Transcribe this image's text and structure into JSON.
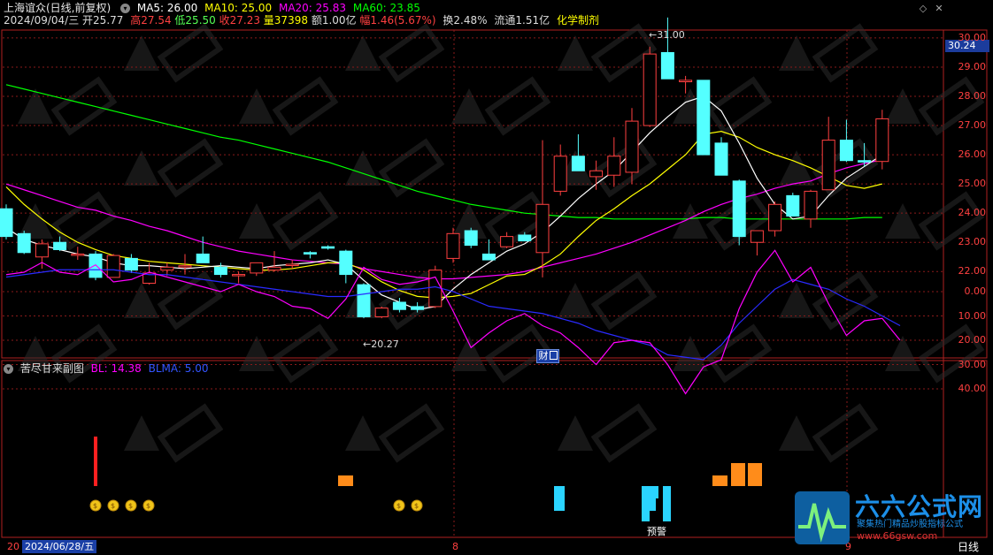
{
  "header": {
    "title": "上海谊众(日线,前复权)",
    "ma": [
      {
        "label": "MA5: 26.00",
        "color": "#ffffff"
      },
      {
        "label": "MA10: 25.00",
        "color": "#ffff00"
      },
      {
        "label": "MA20: 25.83",
        "color": "#ff00ff"
      },
      {
        "label": "MA60: 23.85",
        "color": "#00ff00"
      }
    ],
    "quote": {
      "date": "2024/09/04/三",
      "open_label": "开25.77",
      "high_label": "高27.54",
      "low_label": "低25.50",
      "close_label": "收27.23",
      "volume_label": "量37398",
      "amount_label": "额1.00亿",
      "change_label": "幅1.46(5.67%)",
      "turnover_label": "换2.48%",
      "float_label": "流通1.51亿",
      "industry": "化学制剂"
    }
  },
  "price_axis": {
    "current_price": "30.24",
    "ticks": [
      "30.00",
      "29.00",
      "28.00",
      "27.00",
      "26.00",
      "25.00",
      "24.00",
      "23.00",
      "22.00"
    ]
  },
  "annotations": {
    "high_marker": "31.00",
    "low_marker": "20.27",
    "report_badge": "财",
    "warning_label": "预警"
  },
  "sub_indicator": {
    "title": "苦尽甘来副图",
    "bl_label": "BL: 14.38",
    "blma_label": "BLMA: 5.00",
    "ticks": [
      "40.00",
      "30.00",
      "20.00",
      "10.00",
      "0.00"
    ]
  },
  "footer": {
    "date_badge": "2024/06/28/五",
    "left_tick": "20",
    "month_ticks": [
      "8",
      "9"
    ],
    "period": "日线"
  },
  "logo": {
    "title": "六六公式网",
    "subtitle": "聚集热门精品炒股指标公式",
    "url": "www.66gsw.com"
  },
  "chart_data": {
    "type": "candlestick",
    "colors": {
      "up": "#ff4040",
      "down": "#54ffff"
    },
    "candles": [
      {
        "o": 24.15,
        "h": 24.3,
        "l": 23.1,
        "c": 23.2
      },
      {
        "o": 23.3,
        "h": 23.4,
        "l": 22.6,
        "c": 22.65
      },
      {
        "o": 22.5,
        "h": 23.1,
        "l": 22.1,
        "c": 22.95
      },
      {
        "o": 23.0,
        "h": 23.2,
        "l": 22.7,
        "c": 22.75
      },
      {
        "o": 22.6,
        "h": 22.85,
        "l": 22.4,
        "c": 22.6
      },
      {
        "o": 22.6,
        "h": 22.7,
        "l": 21.7,
        "c": 21.8
      },
      {
        "o": 21.8,
        "h": 22.6,
        "l": 21.8,
        "c": 22.55
      },
      {
        "o": 22.45,
        "h": 22.6,
        "l": 21.95,
        "c": 22.05
      },
      {
        "o": 21.6,
        "h": 22.3,
        "l": 21.55,
        "c": 21.95
      },
      {
        "o": 22.05,
        "h": 22.3,
        "l": 21.85,
        "c": 22.15
      },
      {
        "o": 22.2,
        "h": 22.6,
        "l": 21.9,
        "c": 22.2
      },
      {
        "o": 22.6,
        "h": 23.2,
        "l": 22.3,
        "c": 22.3
      },
      {
        "o": 22.15,
        "h": 22.3,
        "l": 21.8,
        "c": 21.9
      },
      {
        "o": 21.9,
        "h": 22.0,
        "l": 21.6,
        "c": 21.9
      },
      {
        "o": 21.95,
        "h": 22.3,
        "l": 21.85,
        "c": 22.3
      },
      {
        "o": 22.05,
        "h": 22.7,
        "l": 22.0,
        "c": 22.15
      },
      {
        "o": 22.25,
        "h": 22.4,
        "l": 22.1,
        "c": 22.25
      },
      {
        "o": 22.65,
        "h": 22.7,
        "l": 22.45,
        "c": 22.6
      },
      {
        "o": 22.85,
        "h": 22.9,
        "l": 22.75,
        "c": 22.8
      },
      {
        "o": 22.7,
        "h": 22.75,
        "l": 21.6,
        "c": 21.9
      },
      {
        "o": 21.55,
        "h": 21.6,
        "l": 20.4,
        "c": 20.45
      },
      {
        "o": 20.45,
        "h": 20.8,
        "l": 20.4,
        "c": 20.75
      },
      {
        "o": 20.95,
        "h": 21.1,
        "l": 20.6,
        "c": 20.7
      },
      {
        "o": 20.8,
        "h": 20.95,
        "l": 20.6,
        "c": 20.7
      },
      {
        "o": 20.8,
        "h": 22.2,
        "l": 20.75,
        "c": 22.05
      },
      {
        "o": 22.45,
        "h": 23.5,
        "l": 22.3,
        "c": 23.3
      },
      {
        "o": 23.4,
        "h": 23.5,
        "l": 22.8,
        "c": 22.9
      },
      {
        "o": 22.6,
        "h": 23.1,
        "l": 22.4,
        "c": 22.4
      },
      {
        "o": 22.85,
        "h": 23.35,
        "l": 22.8,
        "c": 23.2
      },
      {
        "o": 23.25,
        "h": 23.35,
        "l": 23.05,
        "c": 23.05
      },
      {
        "o": 22.65,
        "h": 26.5,
        "l": 21.8,
        "c": 24.3
      },
      {
        "o": 24.75,
        "h": 26.35,
        "l": 24.6,
        "c": 25.95
      },
      {
        "o": 25.95,
        "h": 26.7,
        "l": 25.45,
        "c": 25.45
      },
      {
        "o": 25.25,
        "h": 25.8,
        "l": 24.8,
        "c": 25.45
      },
      {
        "o": 25.3,
        "h": 26.6,
        "l": 24.9,
        "c": 25.95
      },
      {
        "o": 25.4,
        "h": 27.6,
        "l": 25.0,
        "c": 27.15
      },
      {
        "o": 27.0,
        "h": 29.7,
        "l": 26.95,
        "c": 29.45
      },
      {
        "o": 29.5,
        "h": 30.7,
        "l": 28.6,
        "c": 28.6
      },
      {
        "o": 28.5,
        "h": 28.7,
        "l": 28.1,
        "c": 28.55
      },
      {
        "o": 28.55,
        "h": 28.55,
        "l": 26.0,
        "c": 26.0
      },
      {
        "o": 26.4,
        "h": 26.6,
        "l": 25.3,
        "c": 25.3
      },
      {
        "o": 25.1,
        "h": 25.15,
        "l": 22.9,
        "c": 23.2
      },
      {
        "o": 23.0,
        "h": 23.4,
        "l": 22.55,
        "c": 23.4
      },
      {
        "o": 23.4,
        "h": 24.4,
        "l": 23.2,
        "c": 24.3
      },
      {
        "o": 24.6,
        "h": 24.7,
        "l": 23.9,
        "c": 23.9
      },
      {
        "o": 23.8,
        "h": 24.8,
        "l": 23.5,
        "c": 24.75
      },
      {
        "o": 24.8,
        "h": 27.3,
        "l": 24.8,
        "c": 26.5
      },
      {
        "o": 26.5,
        "h": 27.2,
        "l": 25.75,
        "c": 25.8
      },
      {
        "o": 25.8,
        "h": 26.4,
        "l": 25.6,
        "c": 25.75
      },
      {
        "o": 25.77,
        "h": 27.54,
        "l": 25.5,
        "c": 27.23
      }
    ],
    "ma5": [
      23.5,
      23.1,
      22.9,
      22.75,
      22.6,
      22.5,
      22.3,
      22.2,
      22.2,
      22.15,
      22.1,
      22.15,
      22.2,
      22.15,
      22.1,
      22.2,
      22.25,
      22.3,
      22.4,
      22.25,
      21.7,
      21.2,
      20.95,
      20.7,
      20.8,
      21.4,
      21.9,
      22.3,
      22.7,
      22.95,
      23.35,
      23.9,
      24.5,
      25.0,
      25.45,
      26.1,
      26.75,
      27.3,
      27.8,
      28.0,
      27.5,
      26.4,
      25.2,
      24.3,
      23.8,
      23.9,
      24.6,
      25.2,
      25.6,
      26.0
    ],
    "ma10": [
      24.9,
      24.3,
      23.8,
      23.35,
      23.0,
      22.75,
      22.55,
      22.45,
      22.35,
      22.3,
      22.25,
      22.2,
      22.15,
      22.1,
      22.05,
      22.05,
      22.1,
      22.2,
      22.3,
      22.3,
      22.05,
      21.65,
      21.35,
      21.15,
      21.1,
      21.15,
      21.25,
      21.55,
      21.85,
      21.9,
      22.2,
      22.6,
      23.2,
      23.75,
      24.15,
      24.6,
      25.0,
      25.5,
      26.0,
      26.7,
      26.8,
      26.6,
      26.25,
      26.0,
      25.8,
      25.55,
      25.25,
      24.95,
      24.85,
      25.0
    ],
    "ma20": [
      25.0,
      24.8,
      24.6,
      24.4,
      24.2,
      24.1,
      23.9,
      23.75,
      23.55,
      23.4,
      23.2,
      23.0,
      22.85,
      22.7,
      22.6,
      22.5,
      22.4,
      22.35,
      22.3,
      22.25,
      22.1,
      22.0,
      21.9,
      21.8,
      21.75,
      21.75,
      21.8,
      21.85,
      21.9,
      22.0,
      22.15,
      22.3,
      22.45,
      22.6,
      22.8,
      23.0,
      23.25,
      23.5,
      23.75,
      24.05,
      24.3,
      24.5,
      24.65,
      24.85,
      25.0,
      25.1,
      25.35,
      25.55,
      25.7,
      25.83
    ],
    "ma60": [
      28.4,
      28.25,
      28.1,
      27.95,
      27.8,
      27.65,
      27.5,
      27.35,
      27.2,
      27.05,
      26.9,
      26.75,
      26.6,
      26.5,
      26.35,
      26.2,
      26.05,
      25.9,
      25.75,
      25.55,
      25.35,
      25.15,
      24.95,
      24.75,
      24.6,
      24.45,
      24.3,
      24.2,
      24.1,
      24.0,
      23.95,
      23.9,
      23.85,
      23.85,
      23.8,
      23.8,
      23.8,
      23.8,
      23.8,
      23.85,
      23.85,
      23.8,
      23.8,
      23.8,
      23.8,
      23.8,
      23.8,
      23.8,
      23.85,
      23.85
    ],
    "bl": [
      -7,
      -8,
      -12,
      -8,
      -7,
      -11,
      -4,
      -5,
      -8,
      -6,
      -4,
      -2,
      0,
      -3,
      0,
      2,
      6,
      7,
      11,
      3,
      -10,
      -5,
      -3,
      -4,
      -6,
      8,
      23,
      17,
      12,
      9,
      14,
      17,
      23,
      30,
      21,
      20,
      21,
      30,
      42,
      31,
      28,
      7,
      -8,
      -17,
      -4,
      -10,
      5,
      18,
      12,
      11,
      20
    ],
    "blma": [
      -6,
      -7,
      -8,
      -9,
      -9,
      -9,
      -9,
      -8,
      -7,
      -7,
      -6,
      -5,
      -4,
      -3,
      -2,
      -1,
      0,
      1,
      2,
      2,
      1,
      0,
      -1,
      -1,
      -2,
      0,
      3,
      6,
      7,
      8,
      9,
      11,
      13,
      16,
      18,
      20,
      22,
      26,
      27,
      28,
      22,
      13,
      6,
      -1,
      -5,
      -3,
      -1,
      3,
      6,
      10,
      14
    ],
    "ylim_price": [
      20,
      31
    ],
    "ylim_sub": [
      -20,
      45
    ]
  }
}
